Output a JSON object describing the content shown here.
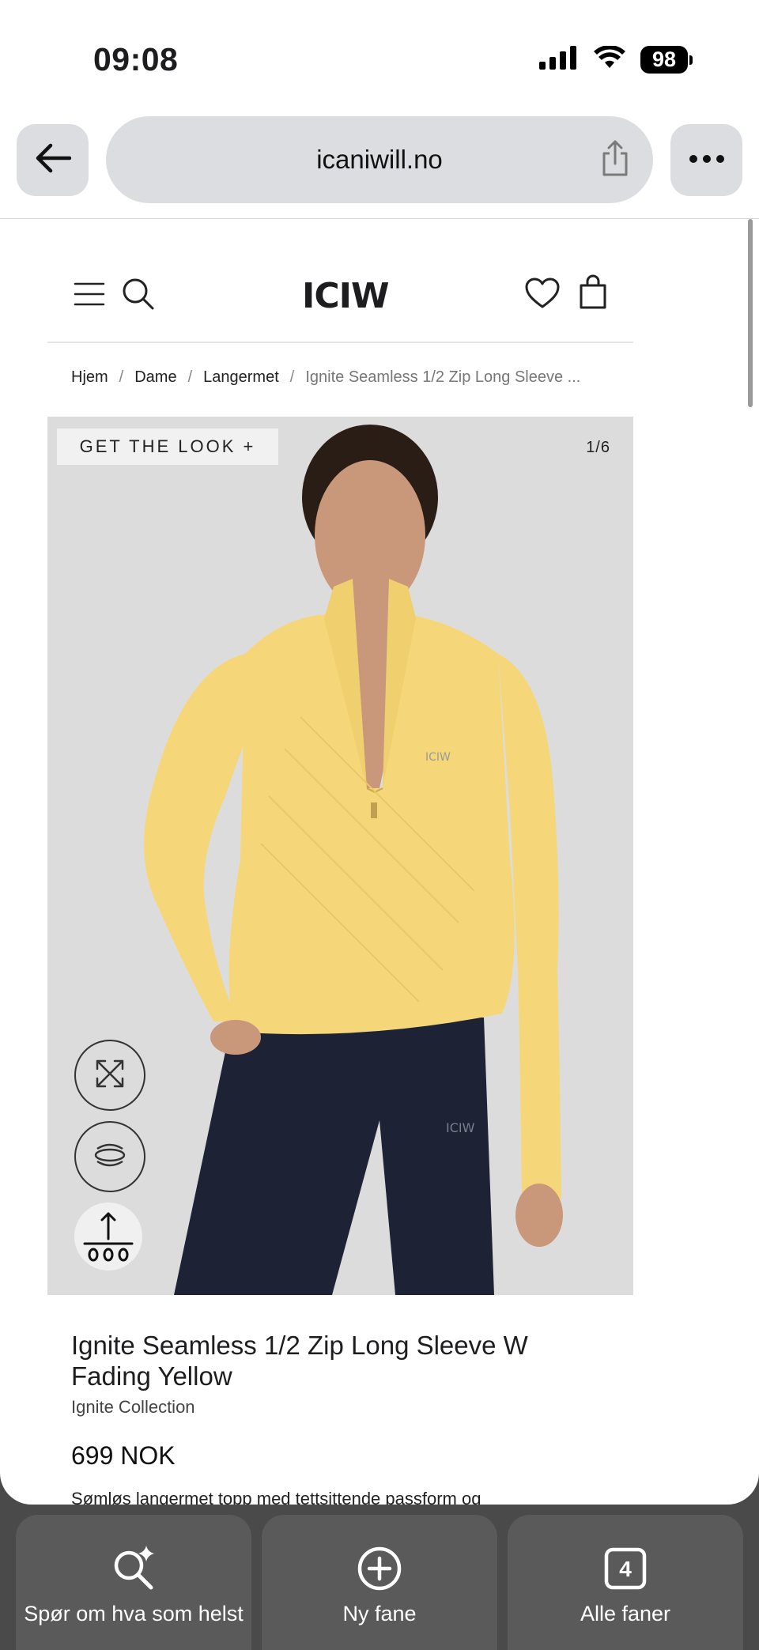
{
  "status_bar": {
    "time": "09:08",
    "battery": "98"
  },
  "browser": {
    "url": "icaniwill.no"
  },
  "site": {
    "logo": "ICIW"
  },
  "breadcrumb": {
    "items": [
      "Hjem",
      "Dame",
      "Langermet"
    ],
    "current": "Ignite Seamless 1/2 Zip Long Sleeve ...",
    "separator": "/"
  },
  "gallery": {
    "get_the_look": "GET THE LOOK +",
    "counter": "1/6",
    "shirt_logo": "ICIW",
    "pants_logo": "ICIW"
  },
  "product": {
    "title_line1": "Ignite Seamless 1/2 Zip Long Sleeve W",
    "title_line2": "Fading Yellow",
    "collection": "Ignite Collection",
    "price": "699 NOK",
    "description": "Sømløs langermet topp med tettsittende passform og"
  },
  "tabs": [
    {
      "label": "Spør om hva som helst",
      "icon": "sparkle-search-icon"
    },
    {
      "label": "Ny fane",
      "icon": "plus-circle-icon"
    },
    {
      "label": "Alle faner",
      "icon": "tabs-count-icon",
      "count": "4"
    }
  ],
  "colors": {
    "shirt": "#f5d77a",
    "pants": "#1e2235",
    "gallery_bg": "#dcdcdd"
  }
}
